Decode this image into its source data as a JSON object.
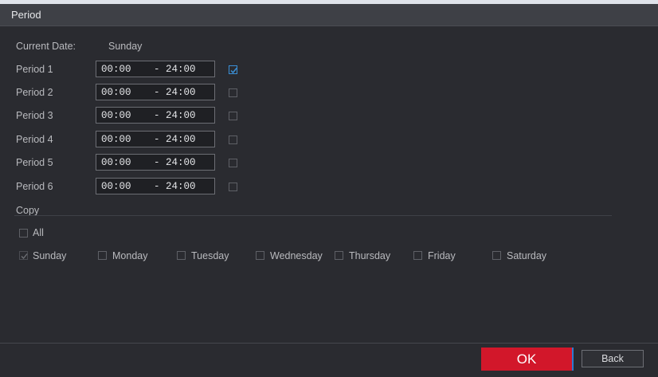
{
  "dialog": {
    "title": "Period"
  },
  "current_date": {
    "label": "Current Date:",
    "value": "Sunday"
  },
  "periods": [
    {
      "label": "Period 1",
      "start": "00:00",
      "end": "- 24:00",
      "enabled": true
    },
    {
      "label": "Period 2",
      "start": "00:00",
      "end": "- 24:00",
      "enabled": false
    },
    {
      "label": "Period 3",
      "start": "00:00",
      "end": "- 24:00",
      "enabled": false
    },
    {
      "label": "Period 4",
      "start": "00:00",
      "end": "- 24:00",
      "enabled": false
    },
    {
      "label": "Period 5",
      "start": "00:00",
      "end": "- 24:00",
      "enabled": false
    },
    {
      "label": "Period 6",
      "start": "00:00",
      "end": "- 24:00",
      "enabled": false
    }
  ],
  "copy": {
    "label": "Copy",
    "all_label": "All",
    "days": [
      {
        "label": "Sunday",
        "checked": true,
        "disabled": true
      },
      {
        "label": "Monday",
        "checked": false
      },
      {
        "label": "Tuesday",
        "checked": false
      },
      {
        "label": "Wednesday",
        "checked": false
      },
      {
        "label": "Thursday",
        "checked": false
      },
      {
        "label": "Friday",
        "checked": false
      },
      {
        "label": "Saturday",
        "checked": false
      }
    ]
  },
  "buttons": {
    "ok": "OK",
    "back": "Back"
  },
  "colors": {
    "ok_bg": "#d2172a",
    "check_accent": "#3a8fd6"
  }
}
